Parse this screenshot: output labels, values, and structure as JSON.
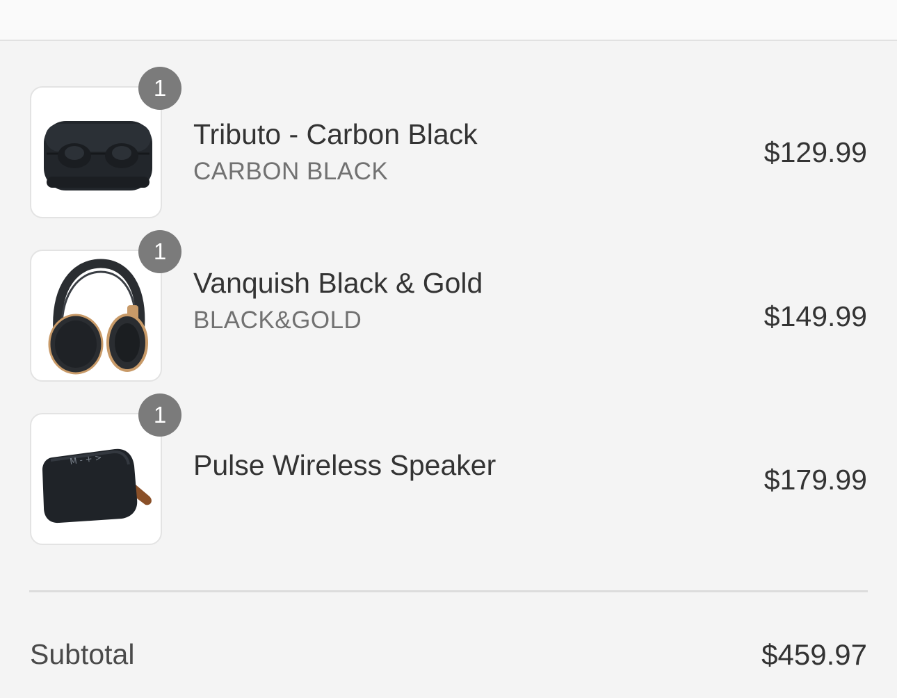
{
  "cart": {
    "items": [
      {
        "name": "Tributo - Carbon Black",
        "variant": "CARBON BLACK",
        "price": "$129.99",
        "quantity": "1",
        "image_icon": "earbuds-case-icon"
      },
      {
        "name": "Vanquish Black & Gold",
        "variant": "BLACK&GOLD",
        "price": "$149.99",
        "quantity": "1",
        "image_icon": "headphones-icon"
      },
      {
        "name": "Pulse Wireless Speaker",
        "variant": "",
        "price": "$179.99",
        "quantity": "1",
        "image_icon": "speaker-icon"
      }
    ]
  },
  "summary": {
    "subtotal_label": "Subtotal",
    "subtotal_value": "$459.97"
  },
  "colors": {
    "background": "#f4f4f4",
    "badge": "#7b7b7b",
    "text": "#333333",
    "muted_text": "#717171"
  }
}
